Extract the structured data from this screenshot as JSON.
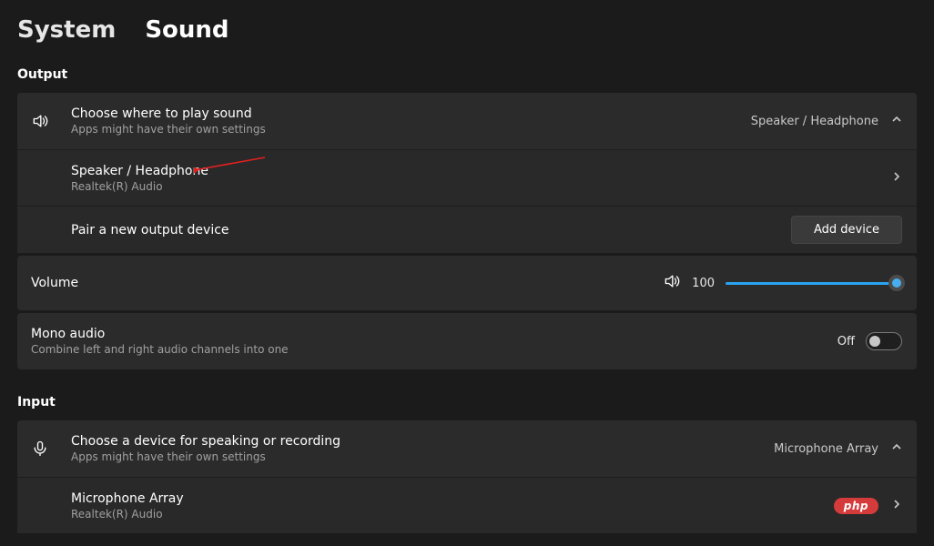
{
  "breadcrumb": {
    "parent": "System",
    "current": "Sound"
  },
  "output": {
    "section_label": "Output",
    "choose": {
      "title": "Choose where to play sound",
      "subtitle": "Apps might have their own settings",
      "current": "Speaker / Headphone"
    },
    "device": {
      "name": "Speaker / Headphone",
      "driver": "Realtek(R) Audio"
    },
    "pair": {
      "label": "Pair a new output device",
      "button": "Add device"
    },
    "volume": {
      "label": "Volume",
      "value": "100"
    },
    "mono": {
      "title": "Mono audio",
      "subtitle": "Combine left and right audio channels into one",
      "state": "Off"
    }
  },
  "input": {
    "section_label": "Input",
    "choose": {
      "title": "Choose a device for speaking or recording",
      "subtitle": "Apps might have their own settings",
      "current": "Microphone Array"
    },
    "device": {
      "name": "Microphone Array",
      "driver": "Realtek(R) Audio"
    },
    "badge": "php"
  }
}
